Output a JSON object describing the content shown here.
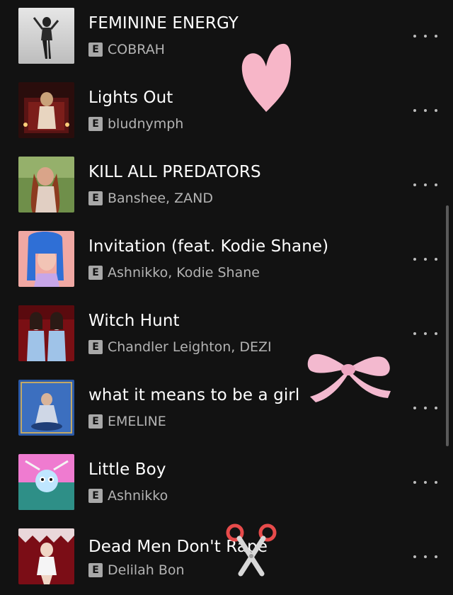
{
  "tracks": [
    {
      "title": "FEMININE ENERGY",
      "explicit": "E",
      "artist": "COBRAH"
    },
    {
      "title": "Lights Out",
      "explicit": "E",
      "artist": "bludnymph"
    },
    {
      "title": "KILL ALL PREDATORS",
      "explicit": "E",
      "artist": "Banshee, ZAND"
    },
    {
      "title": "Invitation (feat. Kodie Shane)",
      "explicit": "E",
      "artist": "Ashnikko, Kodie Shane"
    },
    {
      "title": "Witch Hunt",
      "explicit": "E",
      "artist": "Chandler Leighton, DEZI"
    },
    {
      "title": "what it means to be a girl",
      "explicit": "E",
      "artist": "EMELINE"
    },
    {
      "title": "Little Boy",
      "explicit": "E",
      "artist": "Ashnikko"
    },
    {
      "title": "Dead Men Don't Rape",
      "explicit": "E",
      "artist": "Delilah Bon"
    }
  ],
  "colors": {
    "background": "#121212",
    "title": "#ffffff",
    "artist": "#b3b3b3",
    "badge": "#a8a8a8",
    "sticker_pink": "#f7b6c8"
  },
  "icons": {
    "more_options": "more-horizontal-dots-icon",
    "stickers": [
      "heart-sticker",
      "bow-sticker",
      "scissors-sticker"
    ]
  }
}
